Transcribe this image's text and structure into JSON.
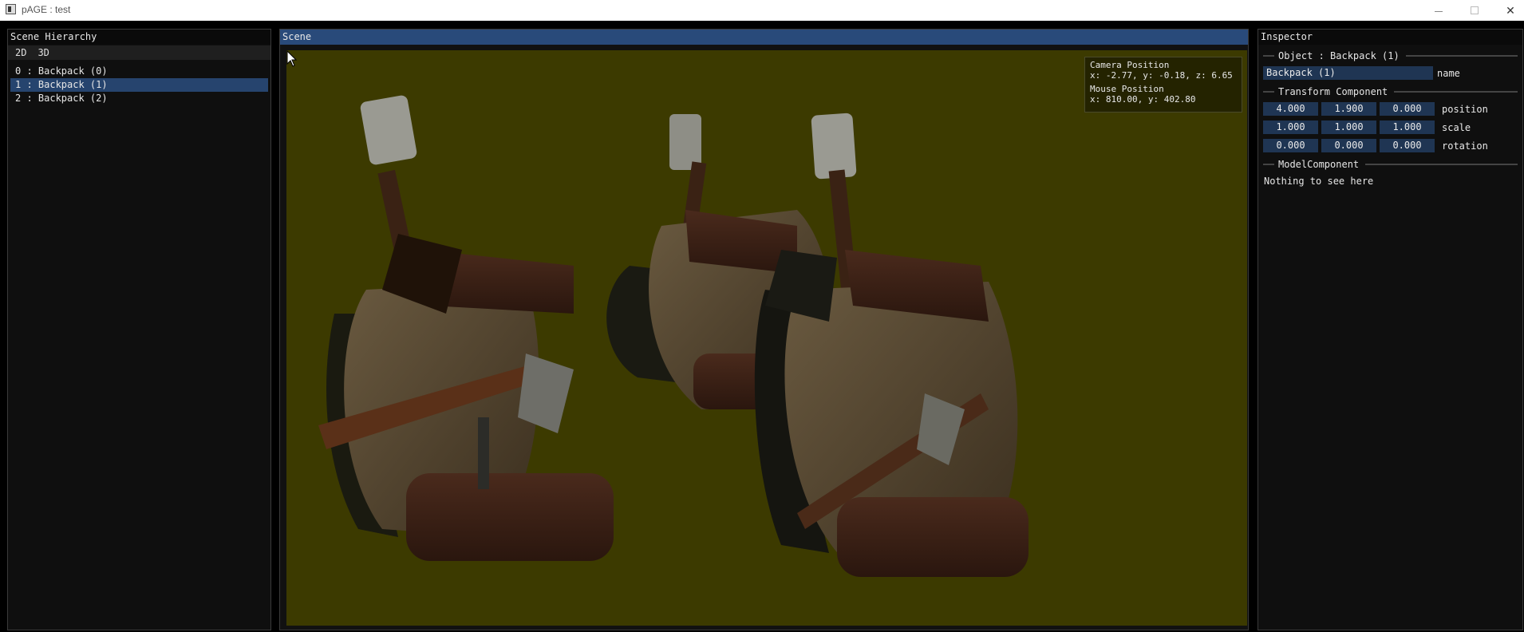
{
  "window": {
    "title": "pAGE : test"
  },
  "hierarchy": {
    "title": "Scene Hierarchy",
    "tabs": [
      "2D",
      "3D"
    ],
    "items": [
      "0 : Backpack (0)",
      "1 : Backpack (1)",
      "2 : Backpack (2)"
    ],
    "selected_index": 1
  },
  "scene": {
    "title": "Scene",
    "background_color": "#3c3a00",
    "overlay": {
      "camera_label": "Camera Position",
      "camera_value": "x: -2.77, y: -0.18, z: 6.65",
      "mouse_label": "Mouse Position",
      "mouse_value": "x: 810.00, y: 402.80"
    }
  },
  "inspector": {
    "title": "Inspector",
    "object_header": "Object : Backpack (1)",
    "name_value": "Backpack (1)",
    "name_label": "name",
    "transform_header": "Transform Component",
    "position": {
      "x": "4.000",
      "y": "1.900",
      "z": "0.000",
      "label": "position"
    },
    "scale": {
      "x": "1.000",
      "y": "1.000",
      "z": "1.000",
      "label": "scale"
    },
    "rotation": {
      "x": "0.000",
      "y": "0.000",
      "z": "0.000",
      "label": "rotation"
    },
    "model_header": "ModelComponent",
    "model_text": "Nothing to see here"
  },
  "colors": {
    "selection": "#26446e",
    "field_bg": "#1f3553",
    "active_title": "#294a7a"
  }
}
